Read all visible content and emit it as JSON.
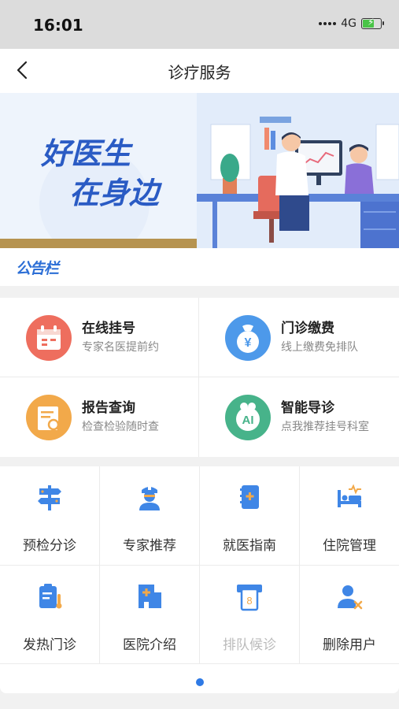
{
  "status_bar": {
    "time": "16:01",
    "network": "4G",
    "battery_level": 0.65
  },
  "header": {
    "title": "诊疗服务"
  },
  "banner": {
    "line1": "好医生",
    "line2": "在身边"
  },
  "notice": {
    "label": "公告栏"
  },
  "services": [
    {
      "name": "在线挂号",
      "desc": "专家名医提前约",
      "icon": "calendar-icon",
      "color": "#ee6e5e"
    },
    {
      "name": "门诊缴费",
      "desc": "线上缴费免排队",
      "icon": "money-bag-icon",
      "color": "#4d99ea"
    },
    {
      "name": "报告查询",
      "desc": "检查检验随时查",
      "icon": "report-search-icon",
      "color": "#f2a94a"
    },
    {
      "name": "智能导诊",
      "desc": "点我推荐挂号科室",
      "icon": "ai-icon",
      "color": "#47b38a",
      "icon_text": "AI"
    }
  ],
  "grid": [
    {
      "label": "预检分诊",
      "icon": "signpost-icon",
      "enabled": true
    },
    {
      "label": "专家推荐",
      "icon": "doctor-icon",
      "enabled": true
    },
    {
      "label": "就医指南",
      "icon": "guide-book-icon",
      "enabled": true
    },
    {
      "label": "住院管理",
      "icon": "hospital-bed-icon",
      "enabled": true
    },
    {
      "label": "发热门诊",
      "icon": "thermometer-clipboard-icon",
      "enabled": true
    },
    {
      "label": "医院介绍",
      "icon": "hospital-building-icon",
      "enabled": true
    },
    {
      "label": "排队候诊",
      "icon": "queue-ticket-icon",
      "enabled": false
    },
    {
      "label": "删除用户",
      "icon": "delete-user-icon",
      "enabled": true
    }
  ],
  "queue_ticket_number": "8",
  "colors": {
    "accent": "#2f7ae5",
    "icon_blue": "#3f86e6",
    "icon_orange": "#f2a94a"
  }
}
